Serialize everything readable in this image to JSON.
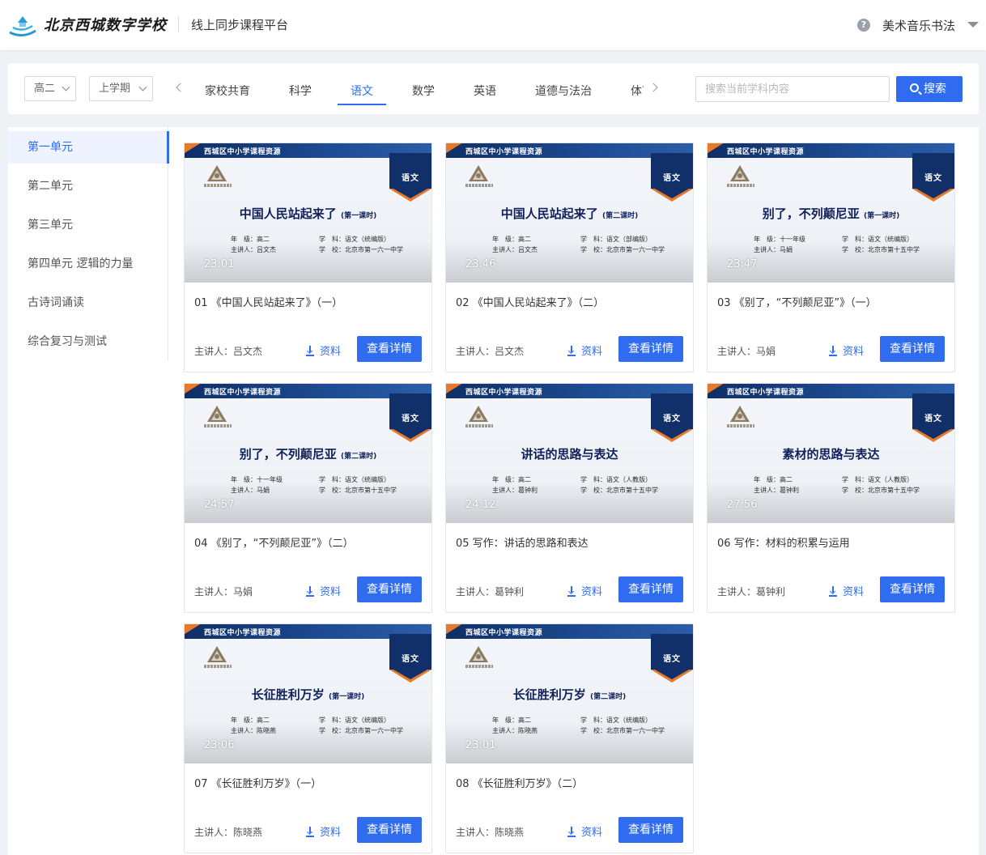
{
  "header": {
    "logo_text": "北京西城数字学校",
    "platform_title": "线上同步课程平台",
    "help_icon": "?",
    "user_name": "美术音乐书法"
  },
  "filter": {
    "grade": "高二",
    "term": "上学期",
    "tabs": [
      "家校共育",
      "科学",
      "语文",
      "数学",
      "英语",
      "道德与法治",
      "体育"
    ],
    "active_tab": "语文",
    "search_placeholder": "搜索当前学科内容",
    "search_button": "搜索"
  },
  "sidebar": {
    "items": [
      "第一单元",
      "第二单元",
      "第三单元",
      "第四单元 逻辑的力量",
      "古诗词诵读",
      "综合复习与测试"
    ],
    "active": "第一单元"
  },
  "card_labels": {
    "resource": "资料",
    "detail": "查看详情",
    "speaker_prefix": "主讲人：",
    "org": "西城区中小学课程资源",
    "subject_tag": "语文"
  },
  "courses": [
    {
      "duration": "23:01",
      "title": "01 《中国人民站起来了》（一）",
      "speaker": "吕文杰",
      "slide_title": "中国人民站起来了",
      "slide_sub": "(第一课时)",
      "grade": "年　级：高二",
      "teacher": "主讲人：吕文杰",
      "subject": "学　科：语文（统编版）",
      "school": "学　校：北京市第一六一中学"
    },
    {
      "duration": "23:46",
      "title": "02 《中国人民站起来了》（二）",
      "speaker": "吕文杰",
      "slide_title": "中国人民站起来了",
      "slide_sub": "(第二课时)",
      "grade": "年　级：高二",
      "teacher": "主讲人：吕文杰",
      "subject": "学　科：语文（部编版）",
      "school": "学　校：北京市第一六一中学"
    },
    {
      "duration": "23:47",
      "title": "03 《别了，“不列颠尼亚”》（一）",
      "speaker": "马娟",
      "slide_title": "别了，不列颠尼亚",
      "slide_sub": "(第一课时)",
      "grade": "年　级：十一年级",
      "teacher": "主讲人：马娟",
      "subject": "学　科：语文（统编版）",
      "school": "学　校：北京市第十五中学"
    },
    {
      "duration": "24:57",
      "title": "04 《别了，“不列颠尼亚”》（二）",
      "speaker": "马娟",
      "slide_title": "别了，不列颠尼亚",
      "slide_sub": "(第二课时)",
      "grade": "年　级：十一年级",
      "teacher": "主讲人：马娟",
      "subject": "学　科：语文（统编版）",
      "school": "学　校：北京市第十五中学"
    },
    {
      "duration": "24:12",
      "title": "05 写作：讲话的思路和表达",
      "speaker": "葛钟利",
      "slide_title": "讲话的思路与表达",
      "slide_sub": "",
      "grade": "年　级：高二",
      "teacher": "主讲人：葛钟利",
      "subject": "学　科：语文（人教版）",
      "school": "学　校：北京市第十五中学"
    },
    {
      "duration": "27:56",
      "title": "06 写作：材料的积累与运用",
      "speaker": "葛钟利",
      "slide_title": "素材的思路与表达",
      "slide_sub": "",
      "grade": "年　级：高二",
      "teacher": "主讲人：葛钟利",
      "subject": "学　科：语文（人教版）",
      "school": "学　校：北京市第十五中学"
    },
    {
      "duration": "23:06",
      "title": "07 《长征胜利万岁》（一）",
      "speaker": "陈晓燕",
      "slide_title": "长征胜利万岁",
      "slide_sub": "(第一课时)",
      "grade": "年　级：高二",
      "teacher": "主讲人：陈晓燕",
      "subject": "学　科：语文（统编版）",
      "school": "学　校：北京市第一六一中学"
    },
    {
      "duration": "23:01",
      "title": "08 《长征胜利万岁》（二）",
      "speaker": "陈晓燕",
      "slide_title": "长征胜利万岁",
      "slide_sub": "(第二课时)",
      "grade": "年　级：高二",
      "teacher": "主讲人：陈晓燕",
      "subject": "学　科：语文（统编版）",
      "school": "学　校：北京市第一六一中学"
    }
  ]
}
